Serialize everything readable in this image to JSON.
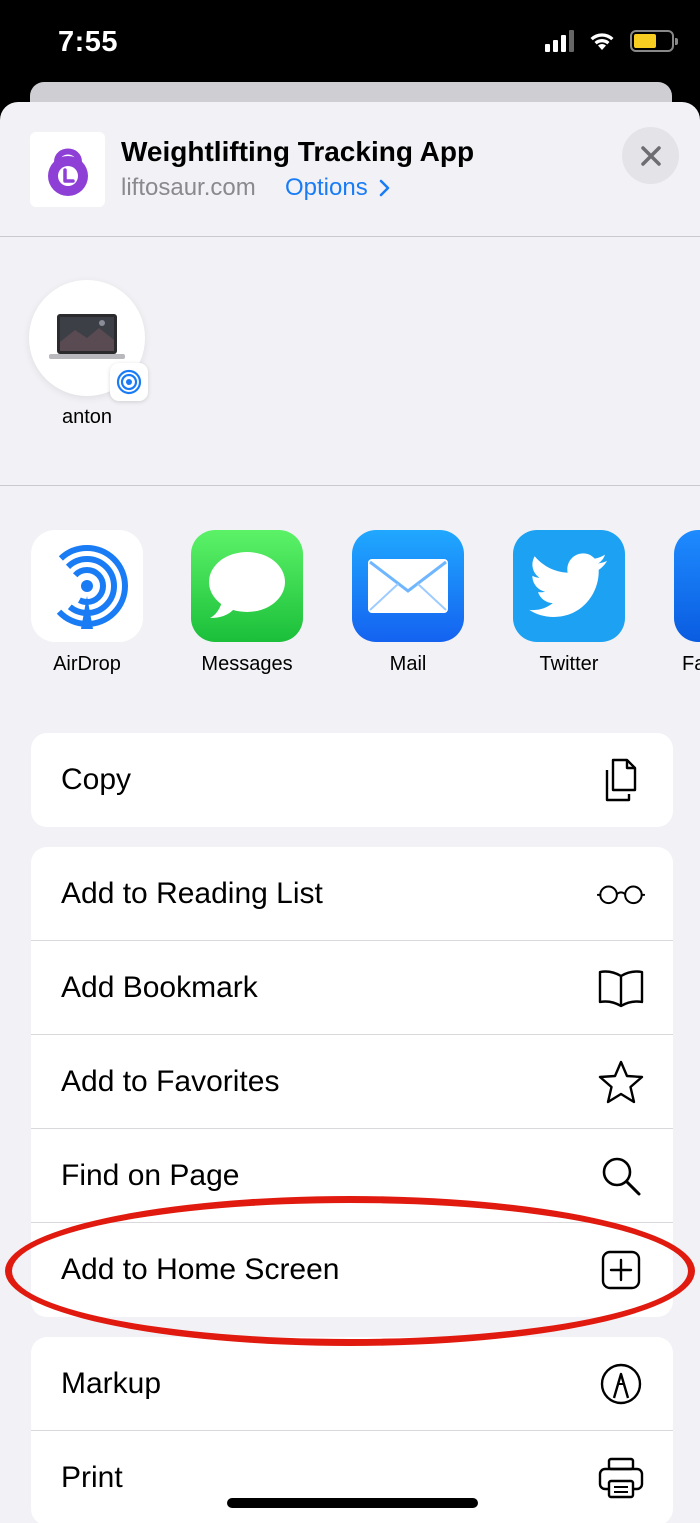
{
  "status_bar": {
    "time": "7:55",
    "battery_color": "#f6cd20"
  },
  "share_header": {
    "title": "Weightlifting Tracking App",
    "url": "liftosaur.com",
    "options_label": "Options",
    "app_icon": "kettlebell-icon",
    "accent_color": "#1a7cf5"
  },
  "airdrop_targets": [
    {
      "name": "anton",
      "icon": "laptop-icon",
      "badge": "airdrop-icon"
    }
  ],
  "share_apps": [
    {
      "label": "AirDrop",
      "icon": "airdrop-icon"
    },
    {
      "label": "Messages",
      "icon": "messages-icon"
    },
    {
      "label": "Mail",
      "icon": "mail-icon"
    },
    {
      "label": "Twitter",
      "icon": "twitter-icon"
    },
    {
      "label": "Fa",
      "icon": "app-icon"
    }
  ],
  "actions": {
    "group1": [
      {
        "label": "Copy",
        "icon": "copy-icon"
      }
    ],
    "group2": [
      {
        "label": "Add to Reading List",
        "icon": "glasses-icon"
      },
      {
        "label": "Add Bookmark",
        "icon": "book-icon"
      },
      {
        "label": "Add to Favorites",
        "icon": "star-icon"
      },
      {
        "label": "Find on Page",
        "icon": "search-icon"
      },
      {
        "label": "Add to Home Screen",
        "icon": "plus-square-icon"
      }
    ],
    "group3": [
      {
        "label": "Markup",
        "icon": "markup-icon"
      },
      {
        "label": "Print",
        "icon": "printer-icon"
      }
    ]
  },
  "annotation_color": "#e11a0f"
}
